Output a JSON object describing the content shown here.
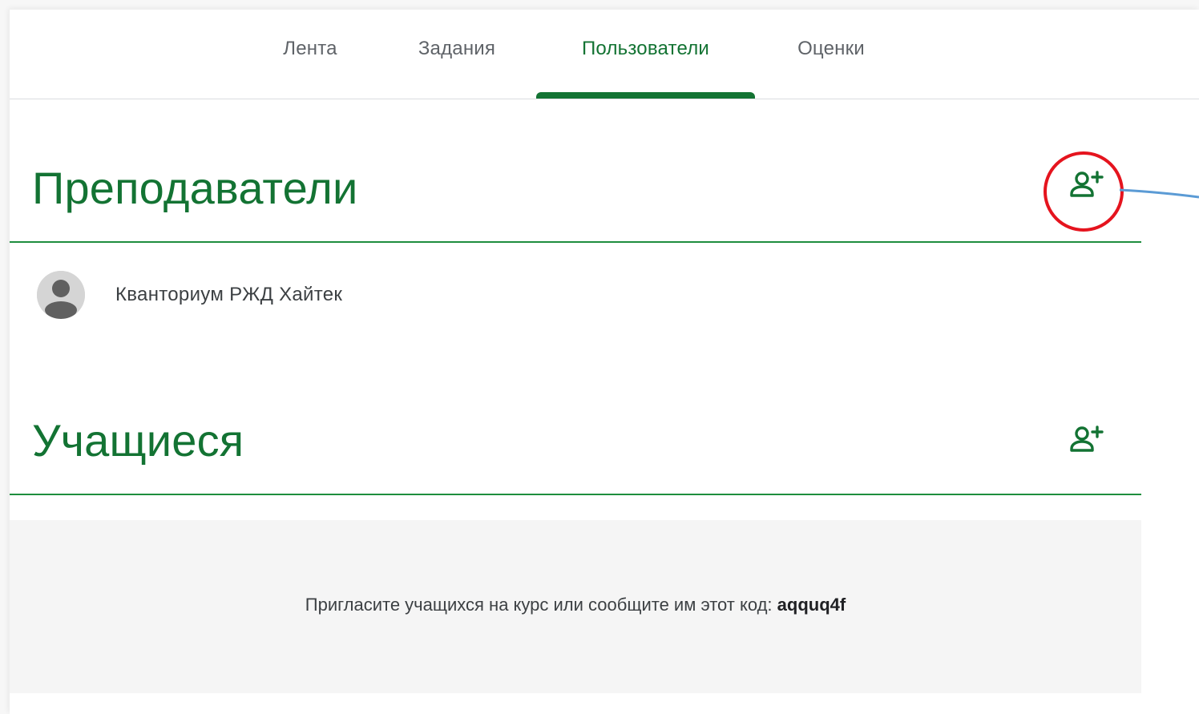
{
  "tabs": [
    {
      "label": "Лента",
      "active": false
    },
    {
      "label": "Задания",
      "active": false
    },
    {
      "label": "Пользователи",
      "active": true
    },
    {
      "label": "Оценки",
      "active": false
    }
  ],
  "teachers": {
    "title": "Преподаватели",
    "add_icon": "person-add-icon",
    "list": [
      {
        "name": "Кванториум РЖД Хайтек"
      }
    ]
  },
  "students": {
    "title": "Учащиеся",
    "add_icon": "person-add-icon",
    "invite_text": "Пригласите учащихся на курс или сообщите им этот код:",
    "code": "aqquq4f"
  },
  "colors": {
    "accent": "#137333",
    "rule": "#1e8e3e",
    "highlight": "#e5141e",
    "pointer": "#5b9bd5"
  }
}
